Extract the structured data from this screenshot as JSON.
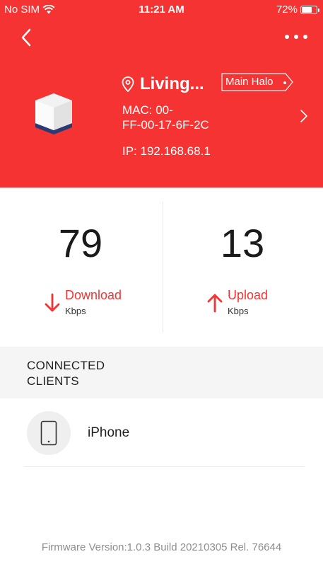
{
  "status_bar": {
    "carrier": "No SIM",
    "time": "11:21 AM",
    "battery_percent": "72%",
    "battery_level": 0.72
  },
  "colors": {
    "header_red": "#f63333",
    "accent_red": "#f63333",
    "text_dark": "#1a1a1a",
    "muted": "#8e8e8e"
  },
  "device": {
    "location": "Living...",
    "role_tag": "Main Halo",
    "mac_line1": "MAC: 00-",
    "mac_line2": "FF-00-17-6F-2C",
    "ip": "IP: 192.168.68.1"
  },
  "speeds": {
    "download": {
      "value": "79",
      "label": "Download",
      "unit": "Kbps"
    },
    "upload": {
      "value": "13",
      "label": "Upload",
      "unit": "Kbps"
    }
  },
  "clients": {
    "title": "CONNECTED CLIENTS",
    "items": [
      {
        "name": "iPhone",
        "icon": "phone-icon"
      }
    ]
  },
  "firmware": "Firmware Version:1.0.3 Build 20210305 Rel. 76644"
}
